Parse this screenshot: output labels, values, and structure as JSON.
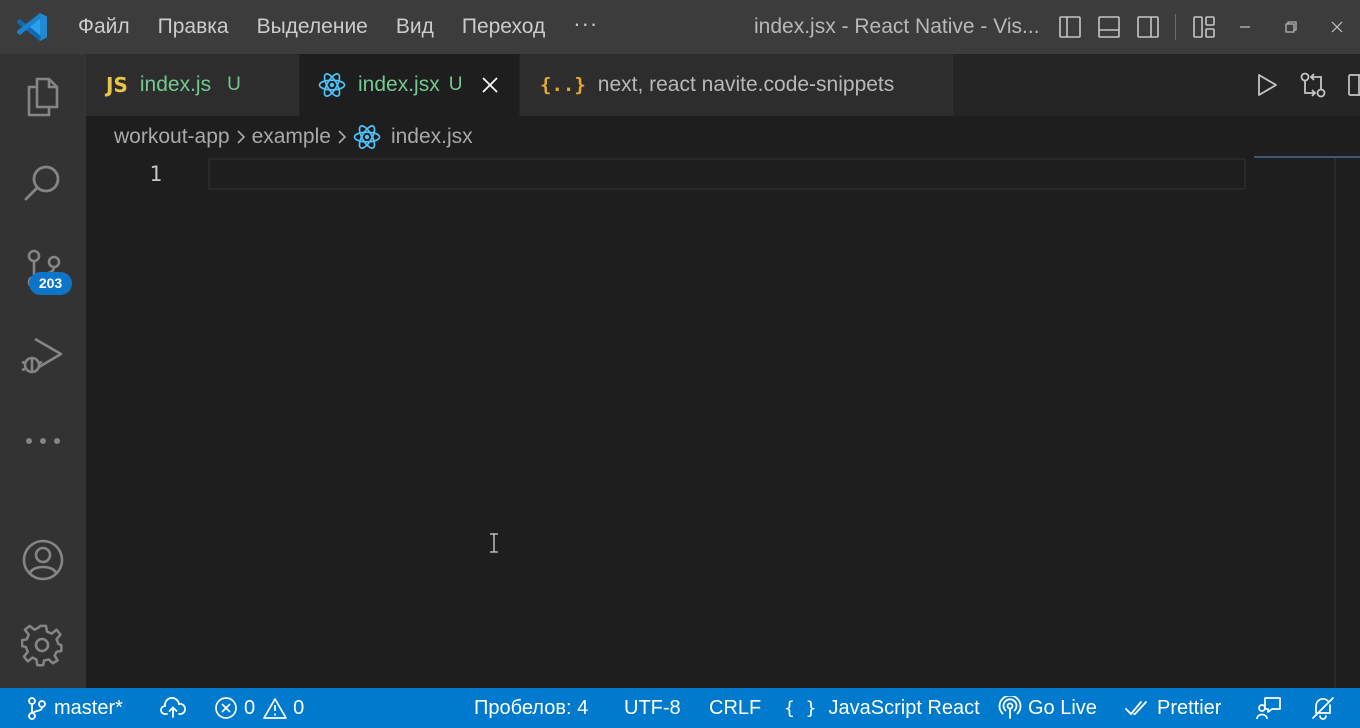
{
  "titlebar": {
    "menu": [
      "Файл",
      "Правка",
      "Выделение",
      "Вид",
      "Переход"
    ],
    "more": "···",
    "window_title": "index.jsx - React Native - Vis..."
  },
  "activitybar": {
    "source_control_badge": "203"
  },
  "tabs": [
    {
      "icon": "JS",
      "label": "index.js",
      "status": "U",
      "label_color": "#73c991"
    },
    {
      "icon": "react-icon",
      "label": "index.jsx",
      "status": "U",
      "label_color": "#73c991",
      "active": true
    },
    {
      "icon": "{..}",
      "label": "next, react navite.code-snippets",
      "label_color": "#b8b8b8"
    }
  ],
  "breadcrumb": [
    "workout-app",
    "example",
    "index.jsx"
  ],
  "editor": {
    "line_numbers": [
      "1"
    ]
  },
  "statusbar": {
    "branch": "master*",
    "errors": "0",
    "warnings": "0",
    "spaces": "Пробелов: 4",
    "encoding": "UTF-8",
    "eol": "CRLF",
    "language_icon": "{ }",
    "language": "JavaScript React",
    "go_live": "Go Live",
    "prettier": "Prettier"
  },
  "colors": {
    "accent": "#007acc",
    "badge": "#0e74c7",
    "untracked": "#73c991",
    "js": "#e8c44a",
    "react": "#4fc3f7"
  }
}
